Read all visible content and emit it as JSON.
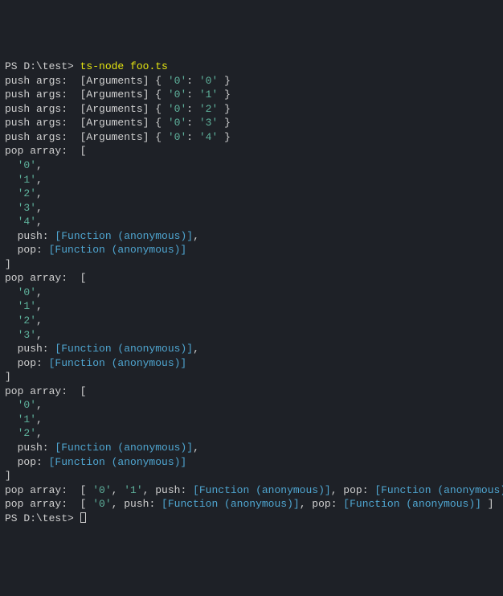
{
  "prompt": "PS D:\\test> ",
  "command": "ts-node foo.ts",
  "push_label": "push args:  ",
  "pop_label": "pop array:  ",
  "args_label": "[Arguments] ",
  "func_text": "[Function (anonymous)]",
  "push_key": "push",
  "pop_key": "pop",
  "zero_key": "'0'",
  "push_rows": [
    {
      "val": "'0'"
    },
    {
      "val": "'1'"
    },
    {
      "val": "'2'"
    },
    {
      "val": "'3'"
    },
    {
      "val": "'4'"
    }
  ],
  "pop_blocks": [
    {
      "items": [
        "'0'",
        "'1'",
        "'2'",
        "'3'",
        "'4'"
      ]
    },
    {
      "items": [
        "'0'",
        "'1'",
        "'2'",
        "'3'"
      ]
    },
    {
      "items": [
        "'0'",
        "'1'",
        "'2'"
      ]
    }
  ],
  "pop_inline": [
    {
      "items": [
        "'0'",
        "'1'"
      ]
    },
    {
      "items": [
        "'0'"
      ]
    }
  ]
}
